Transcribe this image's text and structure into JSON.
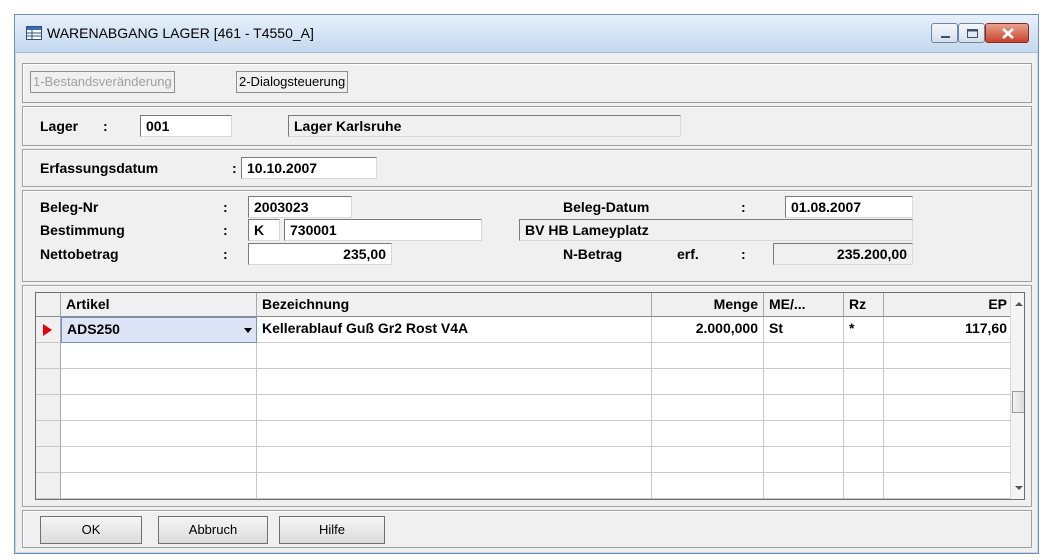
{
  "window": {
    "title": "WARENABGANG LAGER  [461 - T4550_A]",
    "icons": {
      "app": "table-icon",
      "minimize": "minimize-icon",
      "maximize": "maximize-icon",
      "close": "close-icon"
    }
  },
  "tabs": [
    {
      "label": "1-Bestandsveränderung",
      "enabled": false
    },
    {
      "label": "2-Dialogsteuerung",
      "enabled": true
    }
  ],
  "lager": {
    "label": "Lager",
    "colon": ":",
    "code": "001",
    "name": "Lager Karlsruhe"
  },
  "erfassung": {
    "label": "Erfassungsdatum",
    "colon": ":",
    "date": "10.10.2007"
  },
  "beleg": {
    "nr_label": "Beleg-Nr",
    "nr_colon": ":",
    "nr": "2003023",
    "datum_label": "Beleg-Datum",
    "datum_colon": ":",
    "datum": "01.08.2007",
    "bestimmung_label": "Bestimmung",
    "bestimmung_colon": ":",
    "bestimmung_code": "K",
    "bestimmung_nr": "730001",
    "bestimmung_text": "BV HB Lameyplatz",
    "netto_label": "Nettobetrag",
    "netto_colon": ":",
    "netto": "235,00",
    "nbetrag_label": "N-Betrag",
    "nbetrag_erf": "erf.",
    "nbetrag_colon": ":",
    "nbetrag": "235.200,00"
  },
  "grid": {
    "columns": [
      "Artikel",
      "Bezeichnung",
      "Menge",
      "ME/...",
      "Rz",
      "EP"
    ],
    "rows": [
      {
        "artikel": "ADS250",
        "bezeichnung": "Kellerablauf Guß Gr2 Rost V4A",
        "menge": "2.000,000",
        "me": "St",
        "rz": "*",
        "ep": "117,60"
      }
    ],
    "current_row_marker": "current-row-arrow-icon",
    "dropdown_icon": "chevron-down-icon"
  },
  "buttons": {
    "ok": "OK",
    "abbruch": "Abbruch",
    "hilfe": "Hilfe"
  },
  "colors": {
    "titlebar": "#d5e4f5",
    "selected_cell": "#dde4f6",
    "row_marker": "#e8000b",
    "close_button": "#c7432a"
  }
}
